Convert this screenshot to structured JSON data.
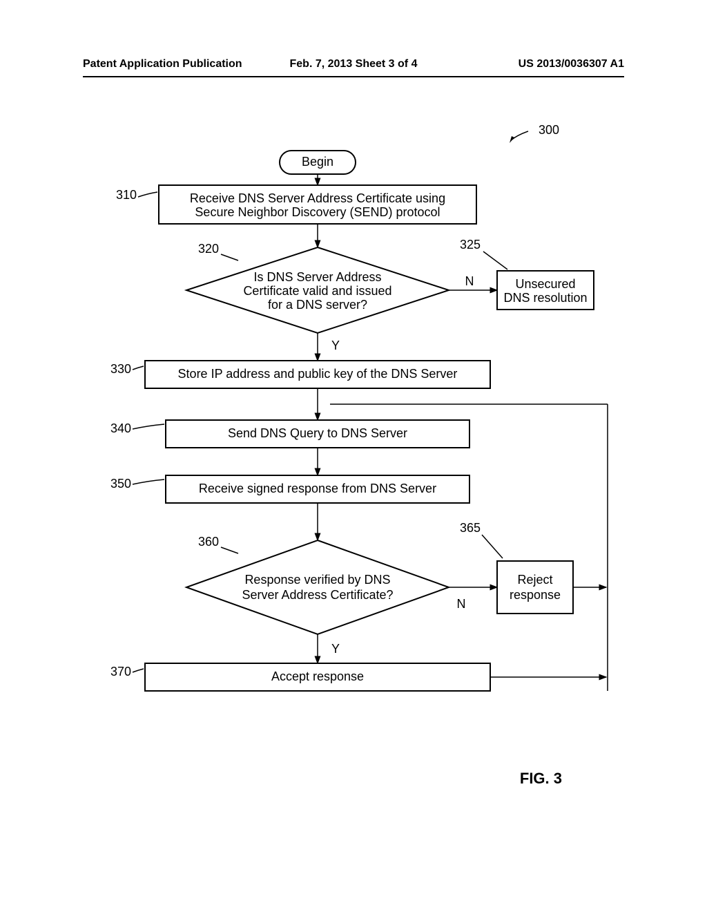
{
  "header": {
    "left": "Patent Application Publication",
    "center": "Feb. 7, 2013   Sheet 3 of 4",
    "right": "US 2013/0036307 A1"
  },
  "figure_label": "FIG. 3",
  "ref": {
    "fig": "300",
    "s310": "310",
    "s320": "320",
    "s325": "325",
    "s330": "330",
    "s340": "340",
    "s350": "350",
    "s360": "360",
    "s365": "365",
    "s370": "370"
  },
  "text": {
    "begin": "Begin",
    "s310a": "Receive DNS Server Address Certificate using",
    "s310b": "Secure Neighbor Discovery (SEND) protocol",
    "s320a": "Is DNS Server Address",
    "s320b": "Certificate valid and issued",
    "s320c": "for a DNS server?",
    "s325a": "Unsecured",
    "s325b": "DNS resolution",
    "s330": "Store IP address and public key of the DNS Server",
    "s340": "Send DNS Query to DNS Server",
    "s350": "Receive signed response from DNS Server",
    "s360a": "Response verified by DNS",
    "s360b": "Server Address Certificate?",
    "s365a": "Reject",
    "s365b": "response",
    "s370": "Accept response",
    "y": "Y",
    "n": "N"
  }
}
